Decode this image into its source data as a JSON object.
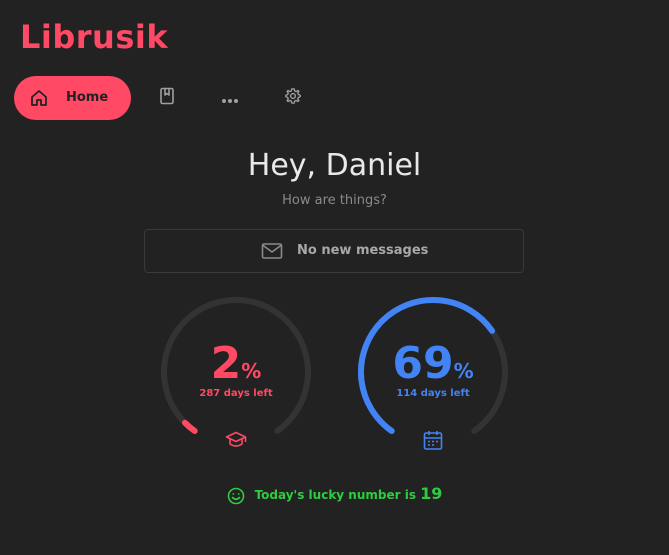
{
  "app": {
    "title": "Librusik"
  },
  "nav": {
    "home_label": "Home",
    "home_icon": "home-icon",
    "book_icon": "book-icon",
    "more_icon": "more-icon",
    "settings_icon": "gear-icon"
  },
  "greeting": {
    "title": "Hey, Daniel",
    "subtitle": "How are things?"
  },
  "messages": {
    "label": "No new messages",
    "icon": "mail-icon"
  },
  "gauges": [
    {
      "value": "2",
      "unit": "%",
      "subtitle": "287 days left",
      "progress": 0.02,
      "color": "#ff4965",
      "icon": "graduation-cap-icon"
    },
    {
      "value": "69",
      "unit": "%",
      "subtitle": "114 days left",
      "progress": 0.69,
      "color": "#4284f5",
      "icon": "calendar-icon"
    }
  ],
  "lucky": {
    "label": "Today's lucky number is",
    "number": "19",
    "icon": "smile-icon"
  },
  "colors": {
    "accent": "#ff4965",
    "blue": "#4284f5",
    "green": "#2ecc40",
    "track": "#333333",
    "background": "#222222"
  }
}
